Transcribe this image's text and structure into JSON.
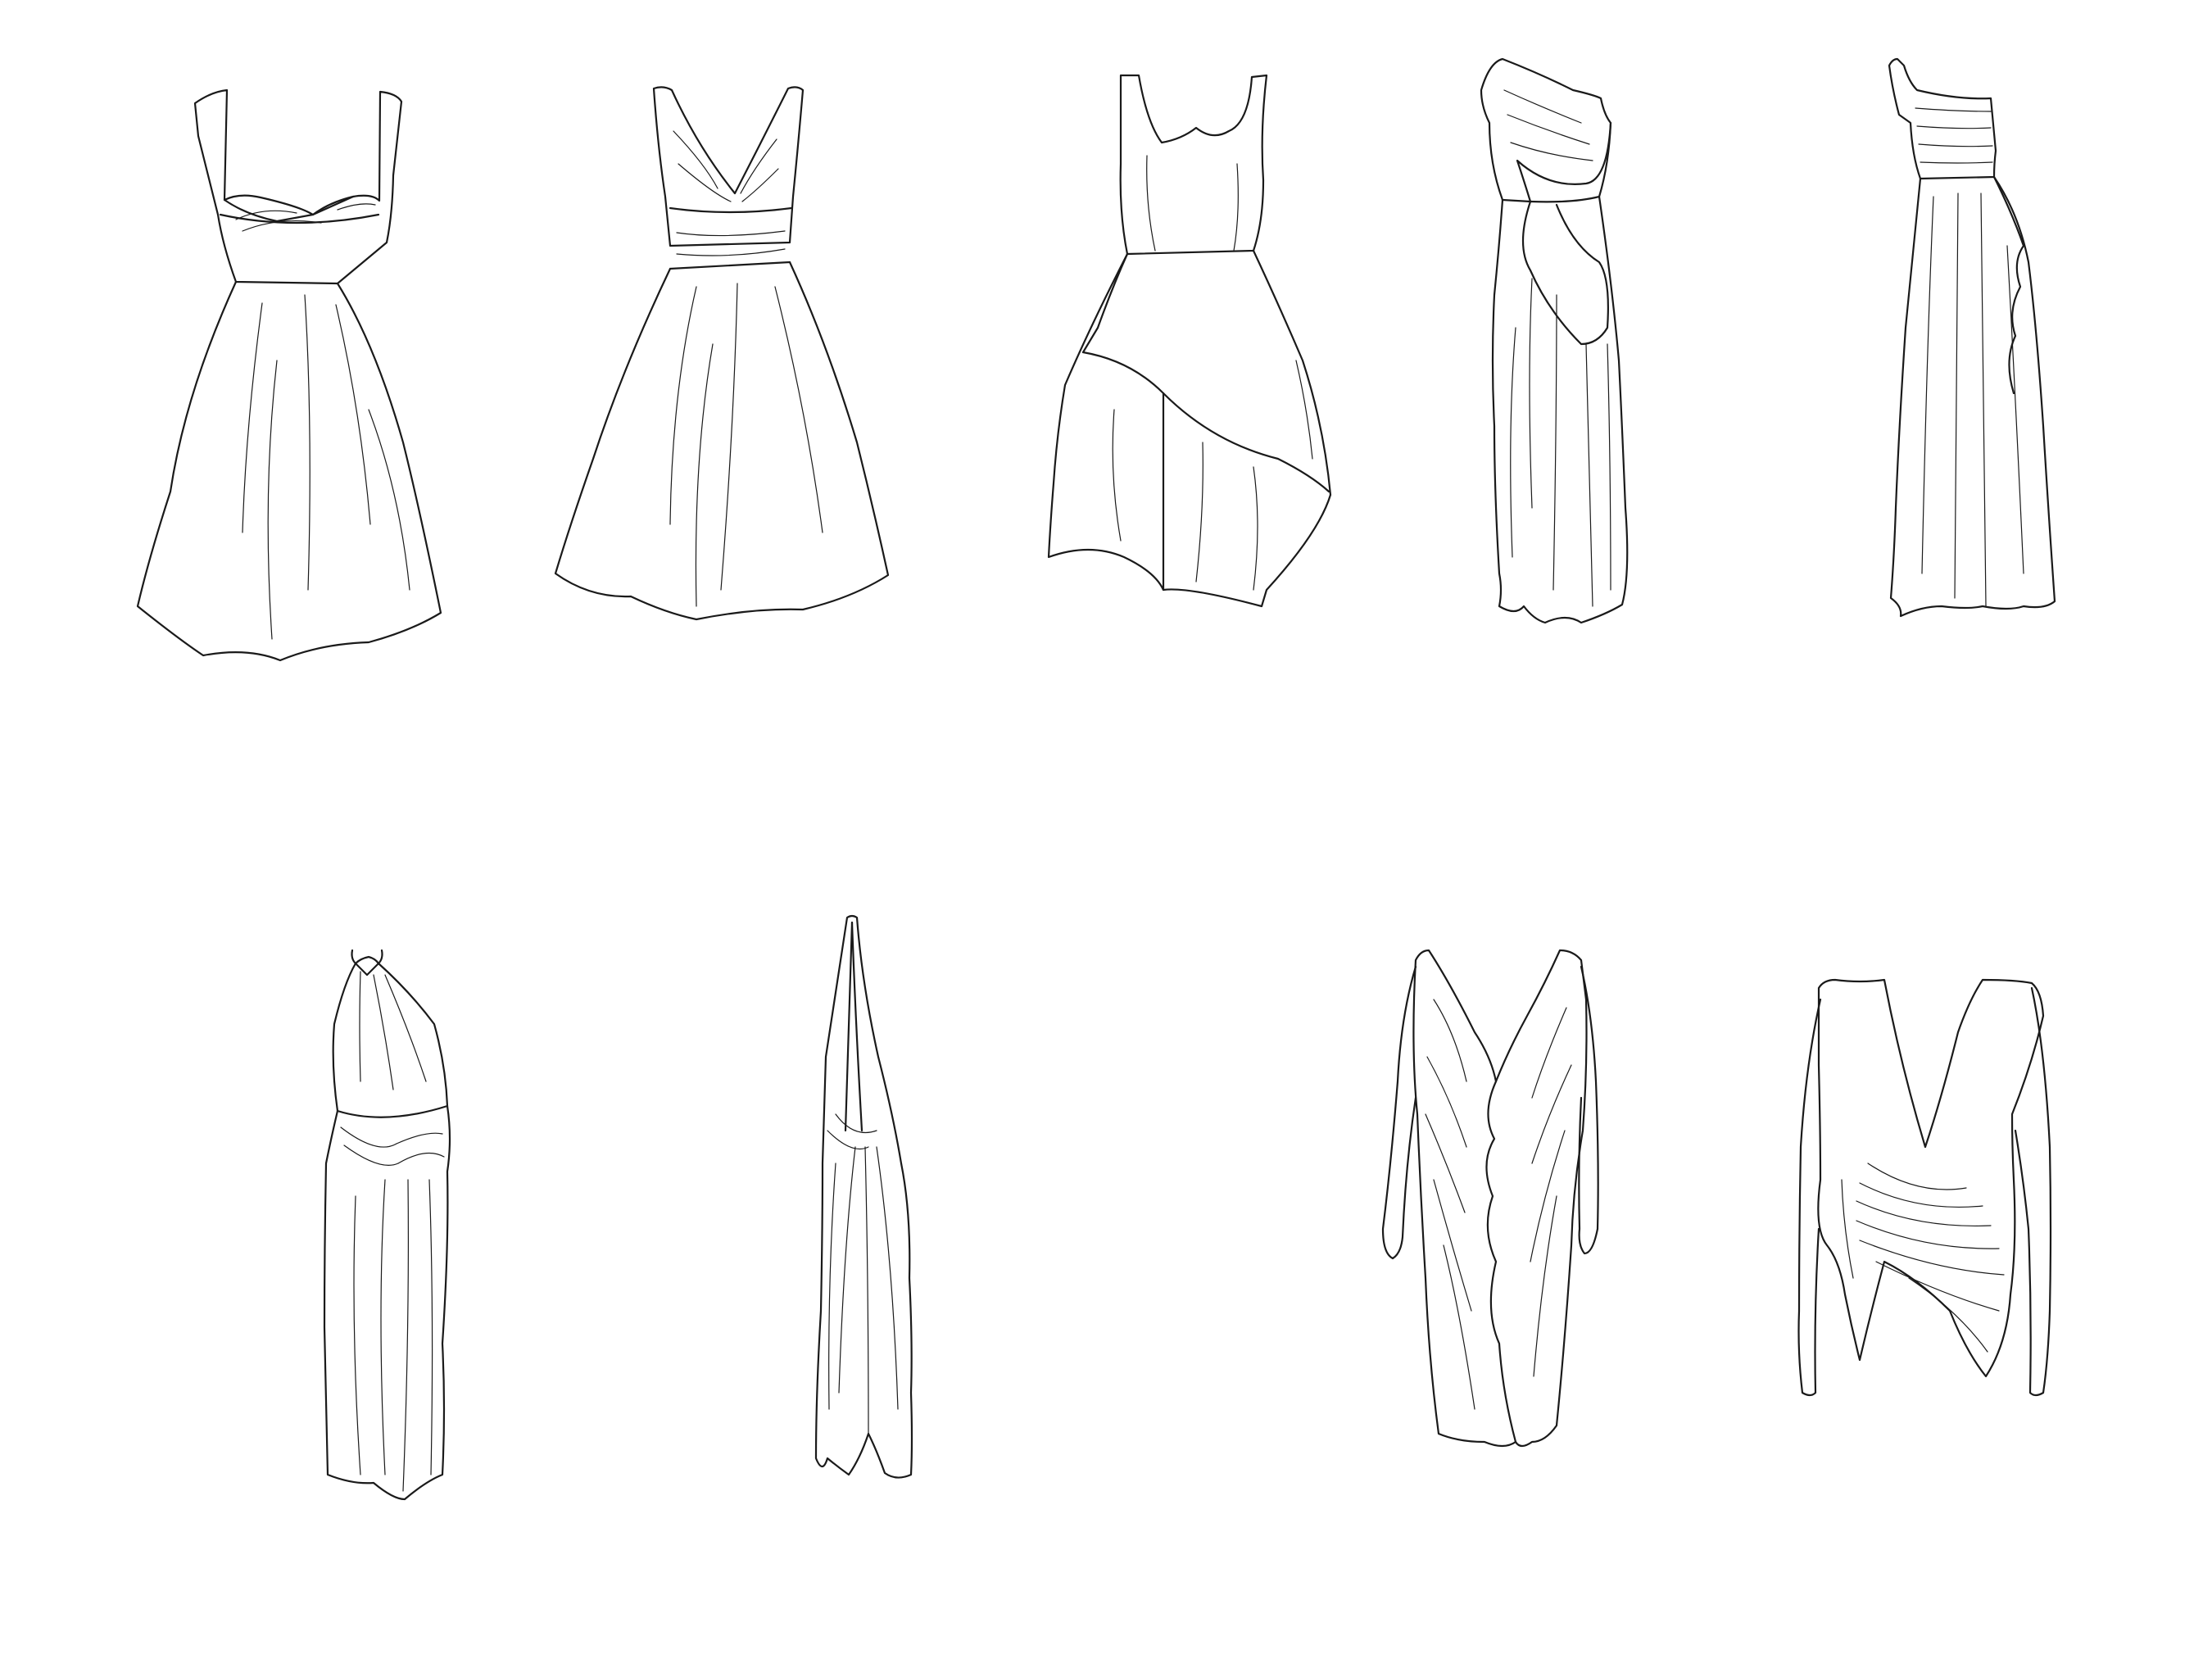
{
  "sheet": {
    "background": "#ffffff",
    "line_color": "#1a1a1a"
  },
  "illustrations": [
    {
      "id": "dress-sweetheart-swing",
      "row": 1,
      "col": 1
    },
    {
      "id": "dress-vneck-sash",
      "row": 1,
      "col": 2
    },
    {
      "id": "dress-asymmetric-hem",
      "row": 1,
      "col": 3
    },
    {
      "id": "gown-one-shoulder-drape",
      "row": 1,
      "col": 4
    },
    {
      "id": "gown-one-shoulder-ruffle",
      "row": 1,
      "col": 5
    },
    {
      "id": "gown-halter-ruched",
      "row": 2,
      "col": 1
    },
    {
      "id": "gown-deep-v-halter",
      "row": 2,
      "col": 2
    },
    {
      "id": "dress-long-sleeve-ruffle",
      "row": 2,
      "col": 3
    },
    {
      "id": "dress-long-sleeve-wrap",
      "row": 2,
      "col": 4
    }
  ]
}
